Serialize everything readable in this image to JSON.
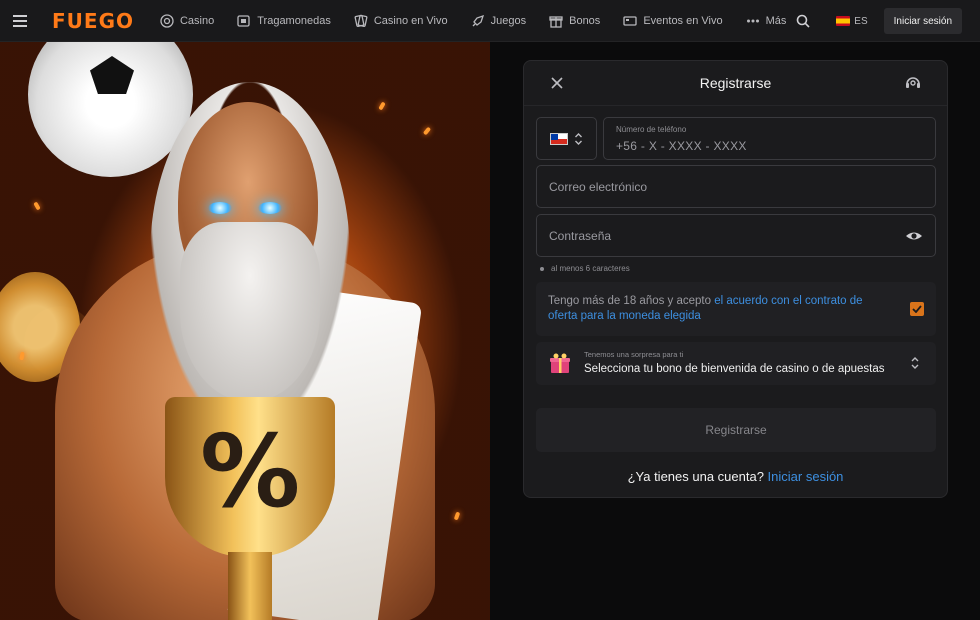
{
  "brand": {
    "logo_text": "FUEGO",
    "accent": "#ff7a18",
    "link_color": "#3d8fe0"
  },
  "nav": {
    "items": [
      {
        "label": "Casino",
        "icon": "casino-chip-icon"
      },
      {
        "label": "Tragamonedas",
        "icon": "slot-machine-icon"
      },
      {
        "label": "Casino en Vivo",
        "icon": "cards-icon"
      },
      {
        "label": "Juegos",
        "icon": "rocket-icon"
      },
      {
        "label": "Bonos",
        "icon": "gift-icon"
      },
      {
        "label": "Eventos en Vivo",
        "icon": "tv-icon"
      },
      {
        "label": "Más",
        "icon": "more-dots-icon"
      }
    ],
    "language": "ES",
    "login_label": "Iniciar sesión"
  },
  "modal": {
    "title": "Registrarse",
    "phone_label": "Número de teléfono",
    "phone_value": "+56 - X - XXXX - XXXX",
    "email_placeholder": "Correo electrónico",
    "password_placeholder": "Contraseña",
    "password_hint": "al menos 6 caracteres",
    "terms_text": "Tengo más de 18 años y acepto ",
    "terms_link": "el acuerdo con el contrato de oferta para la moneda elegida",
    "terms_checked": true,
    "bonus_label": "Tenemos una sorpresa para ti",
    "bonus_value": "Selecciona tu bono de bienvenida de casino o de apuestas",
    "submit_label": "Registrarse",
    "footer_text": "¿Ya tienes una cuenta? ",
    "footer_link": "Iniciar sesión"
  }
}
